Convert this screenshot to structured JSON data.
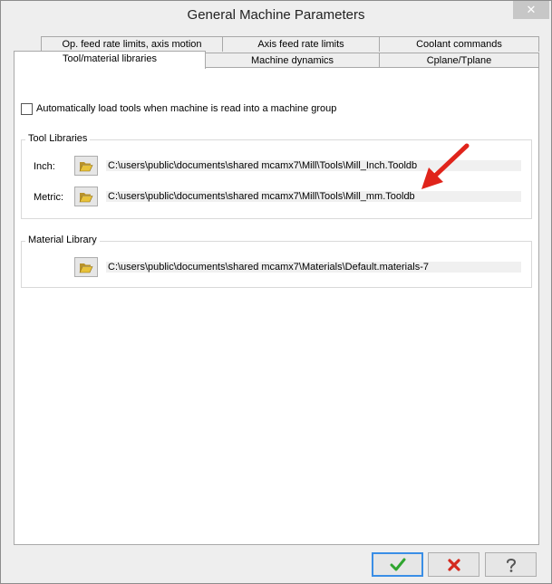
{
  "window": {
    "title": "General Machine Parameters",
    "close_glyph": "✕"
  },
  "tabs": {
    "row1": [
      {
        "label": "Op. feed rate limits, axis motion"
      },
      {
        "label": "Axis feed rate limits"
      },
      {
        "label": "Coolant commands"
      }
    ],
    "row2": [
      {
        "label": "Tool/material libraries",
        "active": true
      },
      {
        "label": "Machine dynamics"
      },
      {
        "label": "Cplane/Tplane"
      }
    ]
  },
  "auto_load": {
    "label": "Automatically load tools when machine is read into a machine group",
    "checked": false
  },
  "tool_libraries": {
    "label": "Tool Libraries",
    "inch_label": "Inch:",
    "inch_path": "C:\\users\\public\\documents\\shared mcamx7\\Mill\\Tools\\Mill_Inch.Tooldb",
    "metric_label": "Metric:",
    "metric_path": "C:\\users\\public\\documents\\shared mcamx7\\Mill\\Tools\\Mill_mm.Tooldb"
  },
  "material_library": {
    "label": "Material Library",
    "path": "C:\\users\\public\\documents\\shared mcamx7\\Materials\\Default.materials-7"
  },
  "colors": {
    "ok_green": "#2fa52f",
    "cancel_red": "#d42a1e",
    "annotation_arrow": "#e0241b",
    "folder_yellow": "#e8c23a"
  },
  "icons": {
    "ok": "check-icon",
    "cancel": "x-icon",
    "help": "question-icon",
    "browse": "folder-open-icon"
  }
}
